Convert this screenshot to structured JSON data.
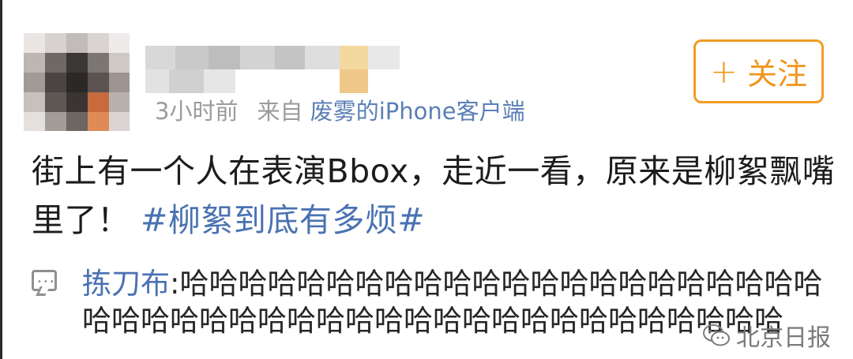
{
  "post": {
    "meta": {
      "time": "3小时前",
      "from_label": "来自",
      "source": "废雾的iPhone客户端"
    },
    "follow_button": {
      "plus": "+",
      "label": "关注"
    },
    "content": {
      "text": "街上有一个人在表演Bbox，走近一看，原来是柳絮飘嘴里了！",
      "hashtag": "#柳絮到底有多烦#"
    }
  },
  "comment": {
    "user": "拣刀布",
    "separator": ":",
    "text": "哈哈哈哈哈哈哈哈哈哈哈哈哈哈哈哈哈哈哈哈哈哈哈哈哈哈哈哈哈哈哈哈哈哈哈哈哈哈哈哈哈哈哈哈哈哈"
  },
  "watermark": {
    "text": "北京日报"
  },
  "colors": {
    "accent": "#f39c23",
    "link": "#4a72b2",
    "meta": "#9b9b9b"
  },
  "icons": {
    "comment": "comment-bubble-icon",
    "watermark": "wechat-icon"
  }
}
